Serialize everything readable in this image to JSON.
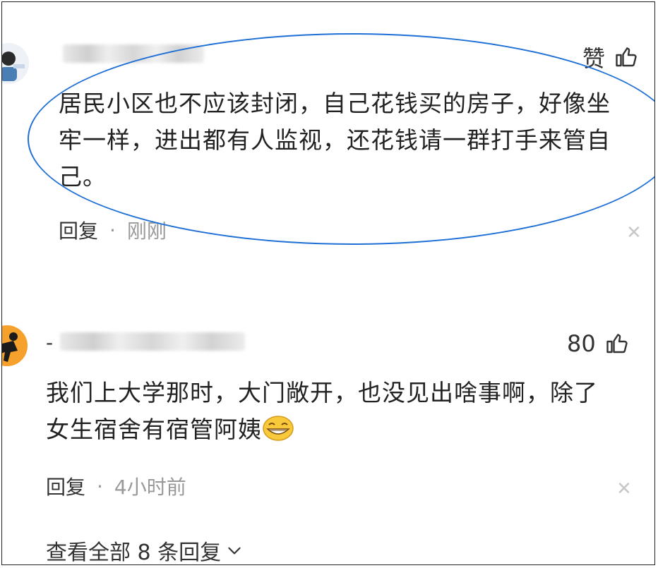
{
  "comments": [
    {
      "username_visible": "",
      "like_label": "赞",
      "text_lines": [
        "居民小区也不应该封闭，自己花钱买的房子，好像坐",
        "牢一样，进出都有人监视，还花钱请一群打手来管自",
        "己。"
      ],
      "reply_label": "回复",
      "time": "刚刚"
    },
    {
      "username_visible": "-",
      "like_label": "80",
      "text_lines": [
        "我们上大学那时，大门敞开，也没见出啥事啊，除了",
        "女生宿舍有宿管阿姨"
      ],
      "reply_label": "回复",
      "time": "4小时前"
    }
  ],
  "view_all_label": "查看全部 8 条回复",
  "colors": {
    "highlight": "#1e6fd6",
    "muted": "#999999",
    "text": "#222222"
  },
  "icons": [
    "thumbs-up-icon",
    "close-icon",
    "grin-emoji-icon",
    "chevron-down-icon"
  ]
}
